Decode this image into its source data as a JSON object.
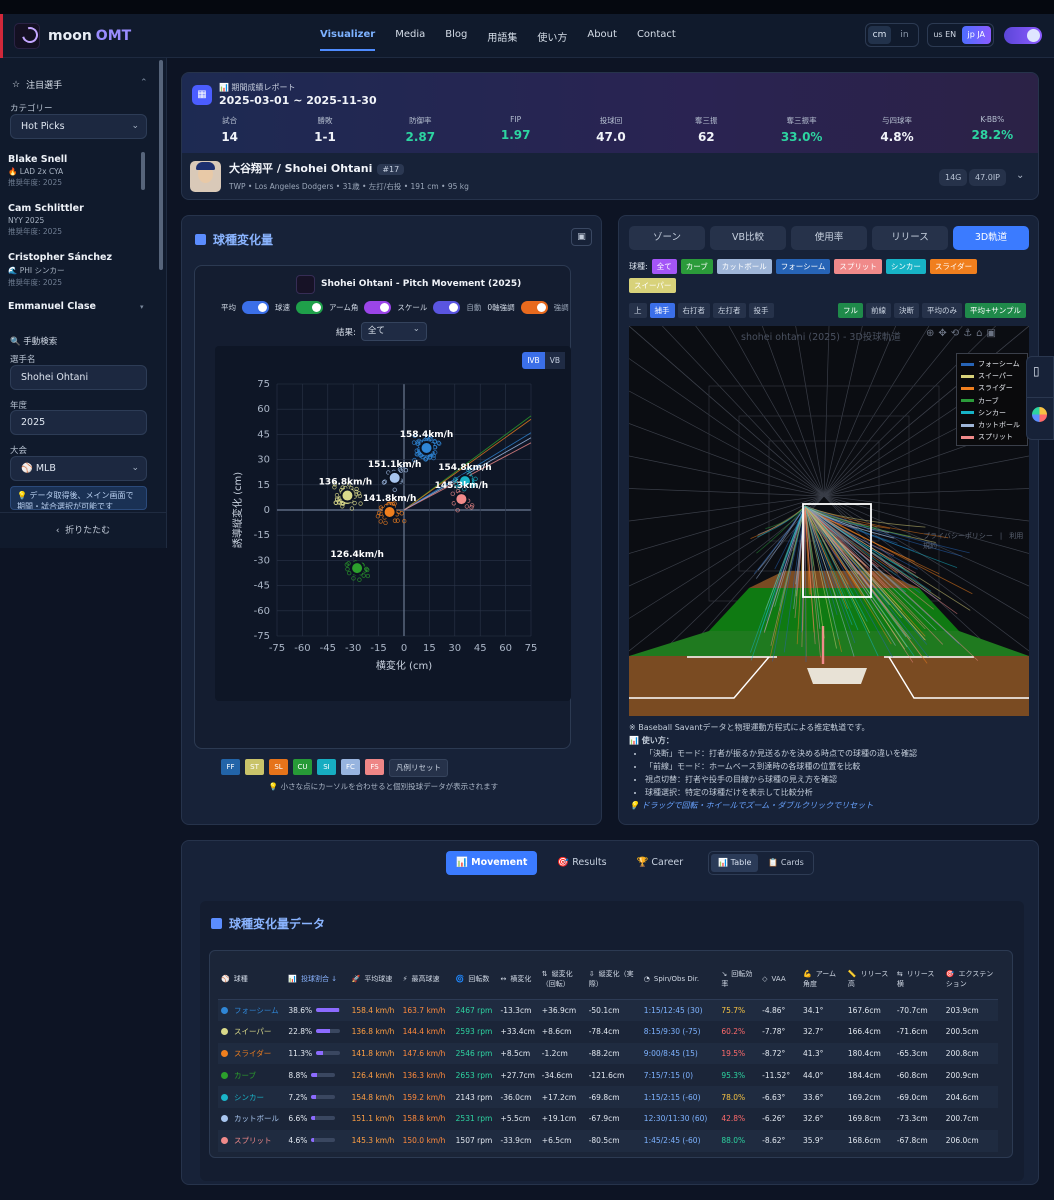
{
  "app": {
    "name": "moon",
    "name2": "OMT",
    "logo_caption": "moonOMT"
  },
  "nav": [
    "Visualizer",
    "Media",
    "Blog",
    "用語集",
    "使い方",
    "About",
    "Contact"
  ],
  "units": [
    "cm",
    "in"
  ],
  "langs": [
    "us EN",
    "jp JA"
  ],
  "sidebar": {
    "section": "注目選手",
    "category_label": "カテゴリー",
    "category": "Hot Picks",
    "pitchers": [
      {
        "name": "Blake Snell",
        "team": "🔥 LAD 2x CYA",
        "year": "推奨年度: 2025"
      },
      {
        "name": "Cam Schlittler",
        "team": "NYY 2025",
        "year": "推奨年度: 2025"
      },
      {
        "name": "Cristopher Sánchez",
        "team": "🌊 PHI シンカー",
        "year": "推奨年度: 2025"
      },
      {
        "name": "Emmanuel Clase",
        "team": "",
        "year": ""
      }
    ],
    "search_section": "🔍 手動検索",
    "player_label": "選手名",
    "player": "Shohei Ohtani",
    "year_label": "年度",
    "year": "2025",
    "league_label": "大会",
    "league": "⚾ MLB",
    "notice": "💡 データ取得後、メイン画面で期間・試合選択が可能です",
    "collapse": "折りたたむ"
  },
  "summary": {
    "label": "📊 期間成績レポート",
    "range": "2025-03-01 ~ 2025-11-30",
    "stats": [
      {
        "l": "試合",
        "v": "14"
      },
      {
        "l": "勝敗",
        "v": "1-1"
      },
      {
        "l": "防御率",
        "v": "2.87"
      },
      {
        "l": "FIP",
        "v": "1.97"
      },
      {
        "l": "投球回",
        "v": "47.0"
      },
      {
        "l": "奪三振",
        "v": "62"
      },
      {
        "l": "奪三振率",
        "v": "33.0%"
      },
      {
        "l": "与四球率",
        "v": "4.8%"
      },
      {
        "l": "K-BB%",
        "v": "28.2%"
      }
    ],
    "player": {
      "name": "大谷翔平 / Shohei Ohtani",
      "number": "#17",
      "detail": "TWP • Los Angeles Dodgers • 31歳 • 左打/右投 • 191 cm • 95 kg",
      "chip1": "14G",
      "chip2": "47.0IP"
    }
  },
  "movement": {
    "title": "球種変化量",
    "chart_title": "Shohei Ohtani - Pitch Movement (2025)",
    "toggles": [
      "平均",
      "球速",
      "アーム角",
      "スケール",
      "自動",
      "0軸強調",
      "強調"
    ],
    "result_label": "結果:",
    "result": "全て",
    "ivb": "IVB",
    "vb": "VB",
    "legend": [
      "FF",
      "ST",
      "SL",
      "CU",
      "SI",
      "FC",
      "FS"
    ],
    "reset": "凡例リセット",
    "hint": "💡 小さな点にカーソルを合わせると個別投球データが表示されます"
  },
  "chart_data": {
    "type": "scatter",
    "xlabel": "横変化 (cm)",
    "ylabel": "誘導縦変化 (cm)",
    "xlim": [
      -75,
      75
    ],
    "ylim": [
      -75,
      75
    ],
    "ticks": [
      -75,
      -60,
      -45,
      -30,
      -15,
      0,
      15,
      30,
      45,
      60,
      75
    ],
    "series": [
      {
        "name": "FF",
        "x": 13.3,
        "y": 36.9,
        "label": "158.4km/h",
        "color": "#2f86d6"
      },
      {
        "name": "ST",
        "x": -33.4,
        "y": 8.6,
        "label": "136.8km/h",
        "color": "#d9d98a"
      },
      {
        "name": "SL",
        "x": -8.5,
        "y": -1.2,
        "label": "141.8km/h",
        "color": "#f07f1e"
      },
      {
        "name": "CU",
        "x": -27.7,
        "y": -34.6,
        "label": "126.4km/h",
        "color": "#2ca02c"
      },
      {
        "name": "SI",
        "x": 36.0,
        "y": 17.2,
        "label": "154.8km/h",
        "color": "#1ab5c9"
      },
      {
        "name": "FC",
        "x": -5.5,
        "y": 19.1,
        "label": "151.1km/h",
        "color": "#a8c5ee"
      },
      {
        "name": "FS",
        "x": 33.9,
        "y": 6.5,
        "label": "145.3km/h",
        "color": "#f08a8a"
      }
    ]
  },
  "trajectory": {
    "tabs": [
      "ゾーン",
      "VB比較",
      "使用率",
      "リリース",
      "3D軌道"
    ],
    "filter_label": "球種:",
    "pitch_filters": [
      {
        "t": "全て",
        "c": "#a455f7"
      },
      {
        "t": "カーブ",
        "c": "#2b9b3a"
      },
      {
        "t": "カットボール",
        "c": "#9fb6d8"
      },
      {
        "t": "フォーシーム",
        "c": "#2764b6"
      },
      {
        "t": "スプリット",
        "c": "#f08a8a"
      },
      {
        "t": "シンカー",
        "c": "#17b3c6"
      },
      {
        "t": "スライダー",
        "c": "#f07f1e"
      },
      {
        "t": "スイーパー",
        "c": "#d8d27a"
      }
    ],
    "views": [
      "上",
      "捕手",
      "右打者",
      "左打者",
      "投手"
    ],
    "modes": [
      "フル",
      "前線",
      "決断",
      "平均のみ",
      "平均+サンプル"
    ],
    "plot_title": "shohei ohtani (2025) - 3D投球軌道",
    "legend": [
      {
        "t": "フォーシーム",
        "c": "#2764b6"
      },
      {
        "t": "スイーパー",
        "c": "#d8d27a"
      },
      {
        "t": "スライダー",
        "c": "#f07f1e"
      },
      {
        "t": "カーブ",
        "c": "#2b9b3a"
      },
      {
        "t": "シンカー",
        "c": "#17b3c6"
      },
      {
        "t": "カットボール",
        "c": "#9fb6d8"
      },
      {
        "t": "スプリット",
        "c": "#f08a8a"
      }
    ],
    "privacy": "プライバシーポリシー　|　利用規約",
    "note": "※ Baseball Savantデータと物理運動方程式による推定軌道です。",
    "howto": "📊 使い方：",
    "bullets": [
      "「決断」モード：打者が振るか見送るかを決める時点での球種の違いを確認",
      "「前線」モード：ホームベース到達時の各球種の位置を比較",
      "視点切替：打者や投手の目線から球種の見え方を確認",
      "球種選択：特定の球種だけを表示して比較分析"
    ],
    "tip": "💡 ドラッグで回転・ホイールでズーム・ダブルクリックでリセット"
  },
  "bottom": {
    "tabs": [
      "📊 Movement",
      "🎯 Results",
      "🏆 Career"
    ],
    "views": [
      "📊 Table",
      "📋 Cards"
    ],
    "title": "球種変化量データ",
    "headers": [
      "球種",
      "投球割合 ↓",
      "平均球速",
      "最高球速",
      "回転数",
      "横変化",
      "縦変化（回転）",
      "縦変化（実際）",
      "Spin/Obs Dir.",
      "回転効率",
      "VAA",
      "アーム角度",
      "リリース高",
      "リリース横",
      "エクステンション"
    ],
    "header_icons": [
      "⚾",
      "📊",
      "🚀",
      "⚡",
      "🌀",
      "↔",
      "⇅",
      "⇩",
      "◔",
      "↘",
      "◇",
      "💪",
      "📏",
      "⇆",
      "🎯"
    ],
    "rows": [
      {
        "name": "フォーシーム",
        "color": "#2f86d6",
        "pct": "38.6%",
        "f": 0.386,
        "avg": "158.4 km/h",
        "max": "163.7 km/h",
        "rpm": "2467 rpm",
        "h": "-13.3cm",
        "v": "+36.9cm",
        "va": "-50.1cm",
        "dir": "1:15/12:45 (30)",
        "eff": "75.7%",
        "vaa": "-4.86°",
        "arm": "34.1°",
        "rh": "167.6cm",
        "rs": "-70.7cm",
        "ext": "203.9cm"
      },
      {
        "name": "スイーパー",
        "color": "#d9d98a",
        "pct": "22.8%",
        "f": 0.228,
        "avg": "136.8 km/h",
        "max": "144.4 km/h",
        "rpm": "2593 rpm",
        "h": "+33.4cm",
        "v": "+8.6cm",
        "va": "-78.4cm",
        "dir": "8:15/9:30 (-75)",
        "eff": "60.2%",
        "vaa": "-7.78°",
        "arm": "32.7°",
        "rh": "166.4cm",
        "rs": "-71.6cm",
        "ext": "200.5cm"
      },
      {
        "name": "スライダー",
        "color": "#f07f1e",
        "pct": "11.3%",
        "f": 0.113,
        "avg": "141.8 km/h",
        "max": "147.6 km/h",
        "rpm": "2546 rpm",
        "h": "+8.5cm",
        "v": "-1.2cm",
        "va": "-88.2cm",
        "dir": "9:00/8:45 (15)",
        "eff": "19.5%",
        "vaa": "-8.72°",
        "arm": "41.3°",
        "rh": "180.4cm",
        "rs": "-65.3cm",
        "ext": "200.8cm"
      },
      {
        "name": "カーブ",
        "color": "#2ca02c",
        "pct": "8.8%",
        "f": 0.088,
        "avg": "126.4 km/h",
        "max": "136.3 km/h",
        "rpm": "2653 rpm",
        "h": "+27.7cm",
        "v": "-34.6cm",
        "va": "-121.6cm",
        "dir": "7:15/7:15 (0)",
        "eff": "95.3%",
        "vaa": "-11.52°",
        "arm": "44.0°",
        "rh": "184.4cm",
        "rs": "-60.8cm",
        "ext": "200.9cm"
      },
      {
        "name": "シンカー",
        "color": "#1ab5c9",
        "pct": "7.2%",
        "f": 0.072,
        "avg": "154.8 km/h",
        "max": "159.2 km/h",
        "rpm": "2143 rpm",
        "h": "-36.0cm",
        "v": "+17.2cm",
        "va": "-69.8cm",
        "dir": "1:15/2:15 (-60)",
        "eff": "78.0%",
        "vaa": "-6.63°",
        "arm": "33.6°",
        "rh": "169.2cm",
        "rs": "-69.0cm",
        "ext": "204.6cm"
      },
      {
        "name": "カットボール",
        "color": "#a8c5ee",
        "pct": "6.6%",
        "f": 0.066,
        "avg": "151.1 km/h",
        "max": "158.8 km/h",
        "rpm": "2531 rpm",
        "h": "+5.5cm",
        "v": "+19.1cm",
        "va": "-67.9cm",
        "dir": "12:30/11:30 (60)",
        "eff": "42.8%",
        "vaa": "-6.26°",
        "arm": "32.6°",
        "rh": "169.8cm",
        "rs": "-73.3cm",
        "ext": "200.7cm"
      },
      {
        "name": "スプリット",
        "color": "#f08a8a",
        "pct": "4.6%",
        "f": 0.046,
        "avg": "145.3 km/h",
        "max": "150.0 km/h",
        "rpm": "1507 rpm",
        "h": "-33.9cm",
        "v": "+6.5cm",
        "va": "-80.5cm",
        "dir": "1:45/2:45 (-60)",
        "eff": "88.0%",
        "vaa": "-8.62°",
        "arm": "35.9°",
        "rh": "168.6cm",
        "rs": "-67.8cm",
        "ext": "206.0cm"
      }
    ]
  }
}
